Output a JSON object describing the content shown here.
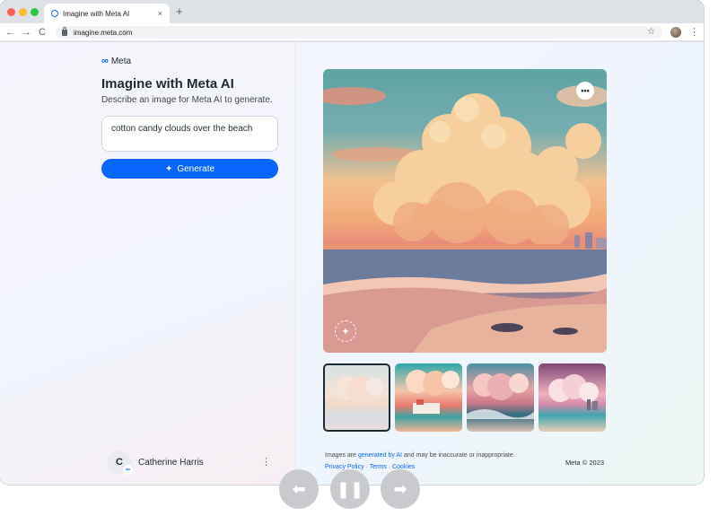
{
  "browser": {
    "tab_title": "Imagine with Meta AI",
    "tab_close_icon": "×",
    "new_tab_icon": "+",
    "url": "imagine.meta.com",
    "nav": {
      "back": "←",
      "forward": "→",
      "reload": "C"
    },
    "bookmark_icon": "☆",
    "menu_icon": "⋮"
  },
  "app": {
    "logo_text": "Meta",
    "title": "Imagine with Meta AI",
    "subtitle": "Describe an image for Meta AI to generate.",
    "prompt_value": "cotton candy clouds over the beach",
    "generate_label": "Generate",
    "more_label": "•••"
  },
  "user": {
    "initial": "C",
    "name": "Catherine Harris",
    "menu_icon": "⋮"
  },
  "thumbnails": [
    {
      "selected": true
    },
    {
      "selected": false
    },
    {
      "selected": false
    },
    {
      "selected": false
    }
  ],
  "footer": {
    "disclaimer_before": "Images are ",
    "disclaimer_link": "generated by AI",
    "disclaimer_after": " and may be inaccurate or inappropriate.",
    "privacy": "Privacy Policy",
    "terms": "Terms",
    "cookies": "Cookies",
    "separator": " · ",
    "copyright": "Meta © 2023"
  },
  "media_controls": {
    "prev_icon": "⬅",
    "pause_icon": "❚❚",
    "next_icon": "➡"
  },
  "colors": {
    "brand_blue": "#0866ff",
    "control_gray": "#c9cacd"
  }
}
